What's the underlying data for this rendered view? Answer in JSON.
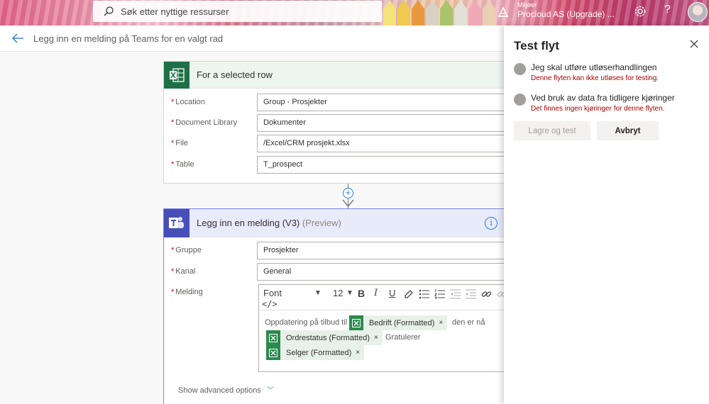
{
  "topbar": {
    "search_placeholder": "Søk etter nyttige ressurser",
    "env_label": "Miljøer",
    "env_name": "Procloud AS (Upgrade) ...",
    "help_glyph": "?"
  },
  "header": {
    "title": "Legg inn en melding på Teams for en valgt rad"
  },
  "trigger_card": {
    "title": "For a selected row",
    "fields": [
      {
        "label": "Location",
        "value": "Group - Prosjekter"
      },
      {
        "label": "Document Library",
        "value": "Dokumenter"
      },
      {
        "label": "File",
        "value": "/Excel/CRM prosjekt.xlsx"
      },
      {
        "label": "Table",
        "value": "T_prospect"
      }
    ]
  },
  "action_card": {
    "title": "Legg inn en melding (V3)",
    "preview": "(Preview)",
    "info_glyph": "i",
    "fields": [
      {
        "label": "Gruppe",
        "value": "Prosjekter"
      },
      {
        "label": "Kanal",
        "value": "General"
      },
      {
        "label": "Melding",
        "value": ""
      }
    ],
    "toolbar": {
      "font": "Font",
      "size": "12",
      "code": "</>"
    },
    "message": {
      "text1": "Oppdatering på tilbud til",
      "text2": "den er nå",
      "text3": "Gratulerer",
      "tokens": [
        {
          "label": "Bedrift (Formatted)"
        },
        {
          "label": "Ordrestatus (Formatted)"
        },
        {
          "label": "Selger (Formatted)"
        }
      ],
      "token_close": "×"
    },
    "advanced": "Show advanced options"
  },
  "panel": {
    "title": "Test flyt",
    "options": [
      {
        "text": "Jeg skal utføre utløserhandlingen",
        "error": "Denne flyten kan ikke utløses for testing."
      },
      {
        "text": "Ved bruk av data fra tidligere kjøringer",
        "error": "Det finnes ingen kjøringer for denne flyten."
      }
    ],
    "save_label": "Lagre og test",
    "cancel_label": "Avbryt"
  },
  "colors": {
    "excel_green": "#1e7145",
    "teams_purple": "#464eb8",
    "error_red": "#a80000",
    "accent_blue": "#2f7ed8"
  }
}
